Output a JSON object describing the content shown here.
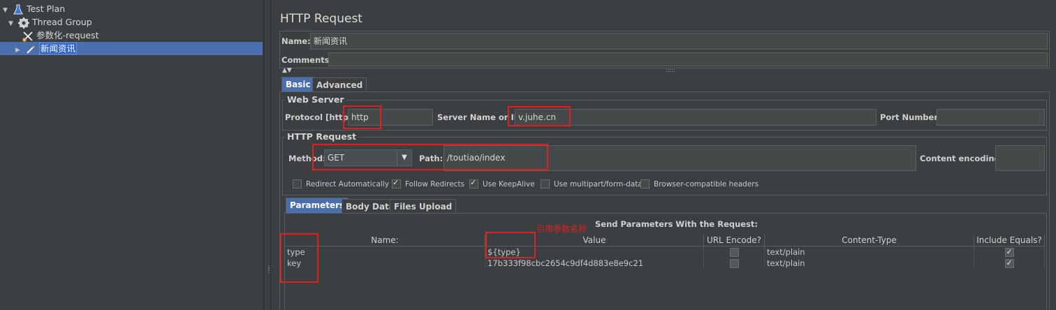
{
  "tree": {
    "items": [
      {
        "label": "Test Plan",
        "icon": "flask-icon",
        "expanded": true
      },
      {
        "label": "Thread Group",
        "icon": "gear-icon",
        "expanded": true
      },
      {
        "label": "参数化-request",
        "icon": "scissors-icon"
      },
      {
        "label": "新闻资讯",
        "icon": "pipette-icon",
        "selected": true
      }
    ]
  },
  "panel": {
    "title": "HTTP Request",
    "name_label": "Name:",
    "name_value": "新闻资讯",
    "comments_label": "Comments:",
    "tabs": [
      "Basic",
      "Advanced"
    ],
    "web_server": {
      "title": "Web Server",
      "protocol_label": "Protocol [http]:",
      "protocol_value": "http",
      "server_label": "Server Name or IP:",
      "server_value": "v.juhe.cn",
      "port_label": "Port Number:",
      "port_value": ""
    },
    "http_request": {
      "title": "HTTP Request",
      "method_label": "Method:",
      "method_value": "GET",
      "path_label": "Path:",
      "path_value": "/toutiao/index",
      "encoding_label": "Content encoding:",
      "encoding_value": ""
    },
    "options": [
      {
        "label": "Redirect Automatically",
        "checked": false
      },
      {
        "label": "Follow Redirects",
        "checked": true
      },
      {
        "label": "Use KeepAlive",
        "checked": true
      },
      {
        "label": "Use multipart/form-data",
        "checked": false
      },
      {
        "label": "Browser-compatible headers",
        "checked": false
      }
    ],
    "sub_tabs": [
      "Parameters",
      "Body Data",
      "Files Upload"
    ],
    "send_params_title": "Send Parameters With the Request:",
    "annotation": "引用参数名称",
    "table": {
      "headers": [
        "Name:",
        "Value",
        "URL Encode?",
        "Content-Type",
        "Include Equals?"
      ],
      "rows": [
        {
          "name": "type",
          "value": "${type}",
          "url_encode": false,
          "content_type": "text/plain",
          "include_equals": true
        },
        {
          "name": "key",
          "value": "17b333f98cbc2654c9df4d883e8e9c21",
          "url_encode": false,
          "content_type": "text/plain",
          "include_equals": true
        }
      ]
    }
  },
  "colors": {
    "background": "#3c3f41",
    "selection": "#4b6eaf",
    "annotation": "#e02020"
  }
}
